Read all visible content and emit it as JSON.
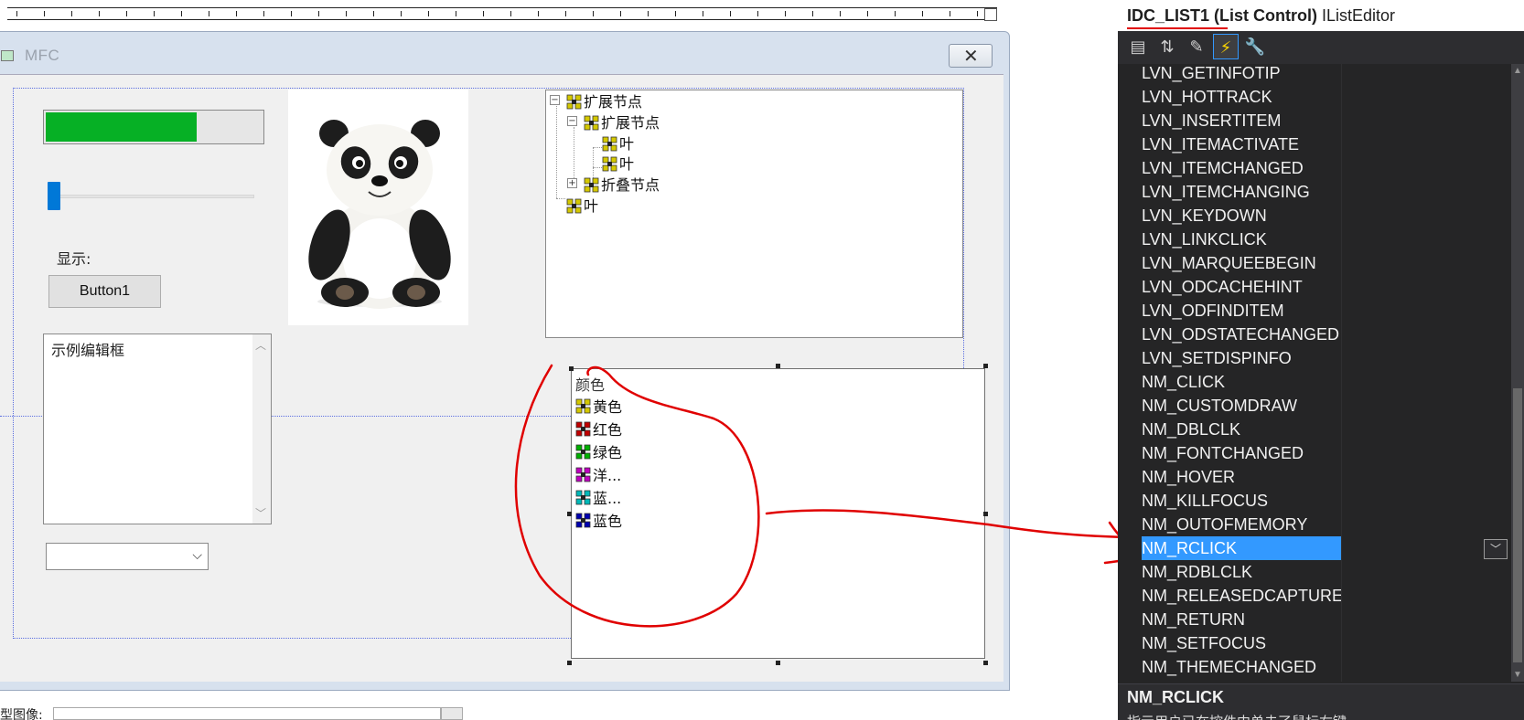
{
  "dialog": {
    "title": "MFC",
    "close_glyph": "✕",
    "progress_fraction": 0.7,
    "slider_fraction": 0.0,
    "static_label": "显示:",
    "button1_label": "Button1",
    "edit_text": "示例编辑框",
    "combo_value": "",
    "picture_desc": "panda"
  },
  "tree": {
    "items": [
      {
        "label": "扩展节点",
        "expander": "−"
      },
      {
        "label": "扩展节点",
        "expander": "−"
      },
      {
        "label": "叶",
        "expander": ""
      },
      {
        "label": "叶",
        "expander": ""
      },
      {
        "label": "折叠节点",
        "expander": "+"
      },
      {
        "label": "叶",
        "expander": ""
      }
    ]
  },
  "list": {
    "header": "颜色",
    "items": [
      {
        "label": "黄色",
        "color": "#d4c800"
      },
      {
        "label": "红色",
        "color": "#c00000"
      },
      {
        "label": "绿色",
        "color": "#00b000"
      },
      {
        "label": "洋...",
        "color": "#c000c0"
      },
      {
        "label": "蓝...",
        "color": "#00b8b8"
      },
      {
        "label": "蓝色",
        "color": "#0000b0"
      }
    ]
  },
  "bottom": {
    "label": "型图像:"
  },
  "properties": {
    "object_name": "IDC_LIST1 (List Control)",
    "interface_name": "IListEditor",
    "toolbar": [
      {
        "name": "categorized-icon",
        "glyph": "▤"
      },
      {
        "name": "alphabetical-icon",
        "glyph": "⇅"
      },
      {
        "name": "properties-icon",
        "glyph": "✎"
      },
      {
        "name": "events-icon",
        "glyph": "⚡"
      },
      {
        "name": "overrides-icon",
        "glyph": "🔧"
      }
    ],
    "rows": [
      "LVN_GETINFOTIP",
      "LVN_HOTTRACK",
      "LVN_INSERTITEM",
      "LVN_ITEMACTIVATE",
      "LVN_ITEMCHANGED",
      "LVN_ITEMCHANGING",
      "LVN_KEYDOWN",
      "LVN_LINKCLICK",
      "LVN_MARQUEEBEGIN",
      "LVN_ODCACHEHINT",
      "LVN_ODFINDITEM",
      "LVN_ODSTATECHANGED",
      "LVN_SETDISPINFO",
      "NM_CLICK",
      "NM_CUSTOMDRAW",
      "NM_DBLCLK",
      "NM_FONTCHANGED",
      "NM_HOVER",
      "NM_KILLFOCUS",
      "NM_OUTOFMEMORY",
      "NM_RCLICK",
      "NM_RDBLCLK",
      "NM_RELEASEDCAPTURE",
      "NM_RETURN",
      "NM_SETFOCUS",
      "NM_THEMECHANGED"
    ],
    "selected_row": "NM_RCLICK",
    "description_title": "NM_RCLICK",
    "description_text": "指示用户已在控件中单击了鼠标右键"
  },
  "colors": {
    "accent": "#3399ff",
    "progress": "#06b025",
    "annotation": "#e00000"
  }
}
